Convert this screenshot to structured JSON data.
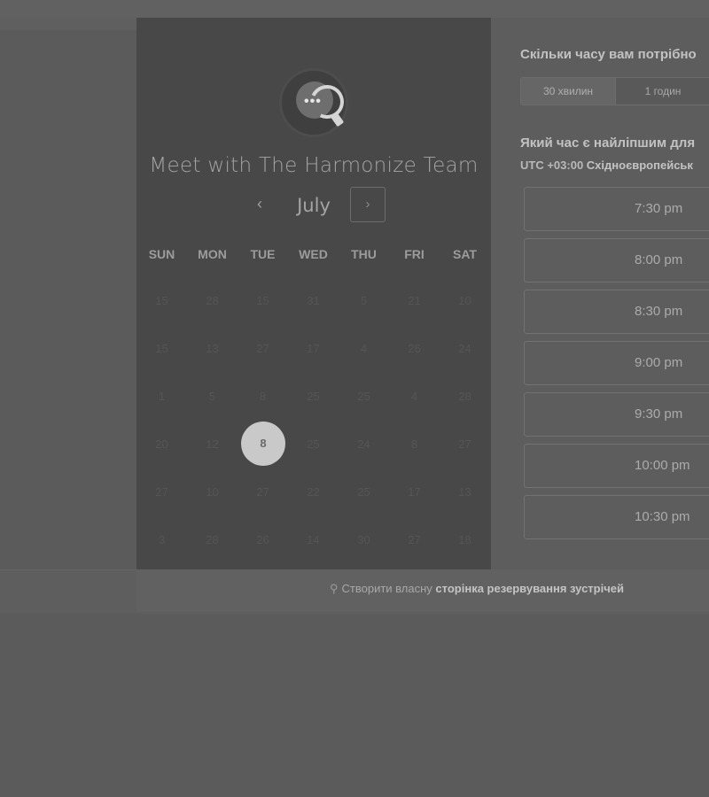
{
  "meeting": {
    "title": "Meet with The Harmonize Team",
    "avatar_icon": "chat-bubble-q-icon",
    "avatar_dots": "•••"
  },
  "calendar": {
    "month": "July",
    "prev_label": "‹",
    "next_label": "›",
    "weekdays": [
      "SUN",
      "MON",
      "TUE",
      "WED",
      "THU",
      "FRI",
      "SAT"
    ],
    "weeks": [
      [
        "15",
        "28",
        "15",
        "31",
        "5",
        "21",
        "10"
      ],
      [
        "15",
        "13",
        "27",
        "17",
        "4",
        "26",
        "24"
      ],
      [
        "1",
        "5",
        "8",
        "25",
        "25",
        "4",
        "28"
      ],
      [
        "20",
        "12",
        "8",
        "25",
        "24",
        "8",
        "27"
      ],
      [
        "27",
        "10",
        "27",
        "22",
        "25",
        "17",
        "13"
      ],
      [
        "3",
        "28",
        "26",
        "14",
        "30",
        "27",
        "18"
      ]
    ],
    "selected": "8"
  },
  "booking": {
    "duration_question": "Скільки часу вам потрібно",
    "durations": [
      "30 хвилин",
      "1 годин"
    ],
    "time_question": "Який час є найліпшим для",
    "timezone_prefix": "UTC +03:00",
    "timezone_name": "Східноєвропейськ",
    "slots": [
      "7:30 pm",
      "8:00 pm",
      "8:30 pm",
      "9:00 pm",
      "9:30 pm",
      "10:00 pm",
      "10:30 pm"
    ]
  },
  "footer": {
    "icon": "hubspot-sprocket-icon",
    "prefix": "Створити власну",
    "bold": "сторінка резервування зустрічей"
  }
}
